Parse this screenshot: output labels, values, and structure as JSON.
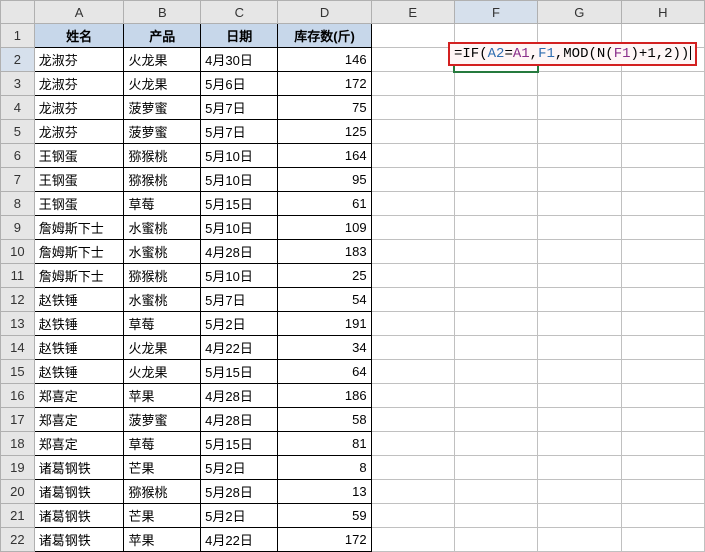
{
  "columns": [
    "A",
    "B",
    "C",
    "D",
    "E",
    "F",
    "G",
    "H"
  ],
  "active_column": "F",
  "active_row": 2,
  "headers": {
    "A": "姓名",
    "B": "产品",
    "C": "日期",
    "D": "库存数(斤)"
  },
  "rows": [
    {
      "r": 2,
      "A": "龙淑芬",
      "B": "火龙果",
      "C": "4月30日",
      "D": 146
    },
    {
      "r": 3,
      "A": "龙淑芬",
      "B": "火龙果",
      "C": "5月6日",
      "D": 172
    },
    {
      "r": 4,
      "A": "龙淑芬",
      "B": "菠萝蜜",
      "C": "5月7日",
      "D": 75
    },
    {
      "r": 5,
      "A": "龙淑芬",
      "B": "菠萝蜜",
      "C": "5月7日",
      "D": 125
    },
    {
      "r": 6,
      "A": "王钢蛋",
      "B": "猕猴桃",
      "C": "5月10日",
      "D": 164
    },
    {
      "r": 7,
      "A": "王钢蛋",
      "B": "猕猴桃",
      "C": "5月10日",
      "D": 95
    },
    {
      "r": 8,
      "A": "王钢蛋",
      "B": "草莓",
      "C": "5月15日",
      "D": 61
    },
    {
      "r": 9,
      "A": "詹姆斯下士",
      "B": "水蜜桃",
      "C": "5月10日",
      "D": 109
    },
    {
      "r": 10,
      "A": "詹姆斯下士",
      "B": "水蜜桃",
      "C": "4月28日",
      "D": 183
    },
    {
      "r": 11,
      "A": "詹姆斯下士",
      "B": "猕猴桃",
      "C": "5月10日",
      "D": 25
    },
    {
      "r": 12,
      "A": "赵铁锤",
      "B": "水蜜桃",
      "C": "5月7日",
      "D": 54
    },
    {
      "r": 13,
      "A": "赵铁锤",
      "B": "草莓",
      "C": "5月2日",
      "D": 191
    },
    {
      "r": 14,
      "A": "赵铁锤",
      "B": "火龙果",
      "C": "4月22日",
      "D": 34
    },
    {
      "r": 15,
      "A": "赵铁锤",
      "B": "火龙果",
      "C": "5月15日",
      "D": 64
    },
    {
      "r": 16,
      "A": "郑喜定",
      "B": "苹果",
      "C": "4月28日",
      "D": 186
    },
    {
      "r": 17,
      "A": "郑喜定",
      "B": "菠萝蜜",
      "C": "4月28日",
      "D": 58
    },
    {
      "r": 18,
      "A": "郑喜定",
      "B": "草莓",
      "C": "5月15日",
      "D": 81
    },
    {
      "r": 19,
      "A": "诸葛钢铁",
      "B": "芒果",
      "C": "5月2日",
      "D": 8
    },
    {
      "r": 20,
      "A": "诸葛钢铁",
      "B": "猕猴桃",
      "C": "5月28日",
      "D": 13
    },
    {
      "r": 21,
      "A": "诸葛钢铁",
      "B": "芒果",
      "C": "5月2日",
      "D": 59
    },
    {
      "r": 22,
      "A": "诸葛钢铁",
      "B": "苹果",
      "C": "4月22日",
      "D": 172
    }
  ],
  "formula": {
    "text": "=IF(A2=A1,F1,MOD(N(F1)+1,2))",
    "tokens": [
      {
        "t": "=",
        "cls": "tok-black"
      },
      {
        "t": "IF(",
        "cls": "tok-black"
      },
      {
        "t": "A2",
        "cls": "tok-cellref"
      },
      {
        "t": "=",
        "cls": "tok-black"
      },
      {
        "t": "A1",
        "cls": "tok-cellref2"
      },
      {
        "t": ",",
        "cls": "tok-black"
      },
      {
        "t": "F1",
        "cls": "tok-cellref"
      },
      {
        "t": ",",
        "cls": "tok-black"
      },
      {
        "t": "MOD(",
        "cls": "tok-black"
      },
      {
        "t": "N(",
        "cls": "tok-black"
      },
      {
        "t": "F1",
        "cls": "tok-cellref2"
      },
      {
        "t": ")",
        "cls": "tok-black"
      },
      {
        "t": "+1,2))",
        "cls": "tok-black"
      }
    ]
  }
}
